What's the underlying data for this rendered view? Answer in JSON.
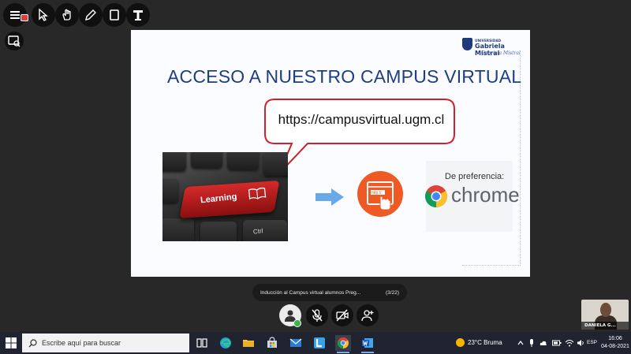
{
  "slide": {
    "logo_top": "UNIVERSIDAD",
    "logo_name": "Gabriela Mistral",
    "logo_signature": "Gabriela Mistral",
    "title": "ACCESO A NUESTRO CAMPUS VIRTUAL",
    "url": "https://campusvirtual.ugm.cl",
    "key_label": "Learning",
    "ctrl_label": "Ctrl",
    "browser_icon_text": "http://",
    "preference_label": "De preferencia:",
    "browser_name": "chrome"
  },
  "caption": {
    "title": "Inducción al Campus virtual alumnos Preg...",
    "page": "(3/22)"
  },
  "thumbnail": {
    "name": "DANIELA G..."
  },
  "taskbar": {
    "search_placeholder": "Escribe aquí para buscar",
    "weather": "23°C  Bruma",
    "language": "ESP",
    "time": "16:06",
    "date": "04-08-2021"
  },
  "colors": {
    "title_blue": "#1e3e84",
    "bubble_border": "#d2202a",
    "arrow_blue": "#6aa9e8",
    "browser_orange": "#ef5a24",
    "taskbar_bg": "#1f2430"
  },
  "icons": {
    "toolbar": [
      "menu-icon",
      "pointer-icon",
      "hand-icon",
      "pen-icon",
      "rectangle-icon",
      "text-stamp-icon"
    ],
    "meeting": [
      "mic-off-icon",
      "camera-off-icon",
      "people-icon"
    ]
  }
}
